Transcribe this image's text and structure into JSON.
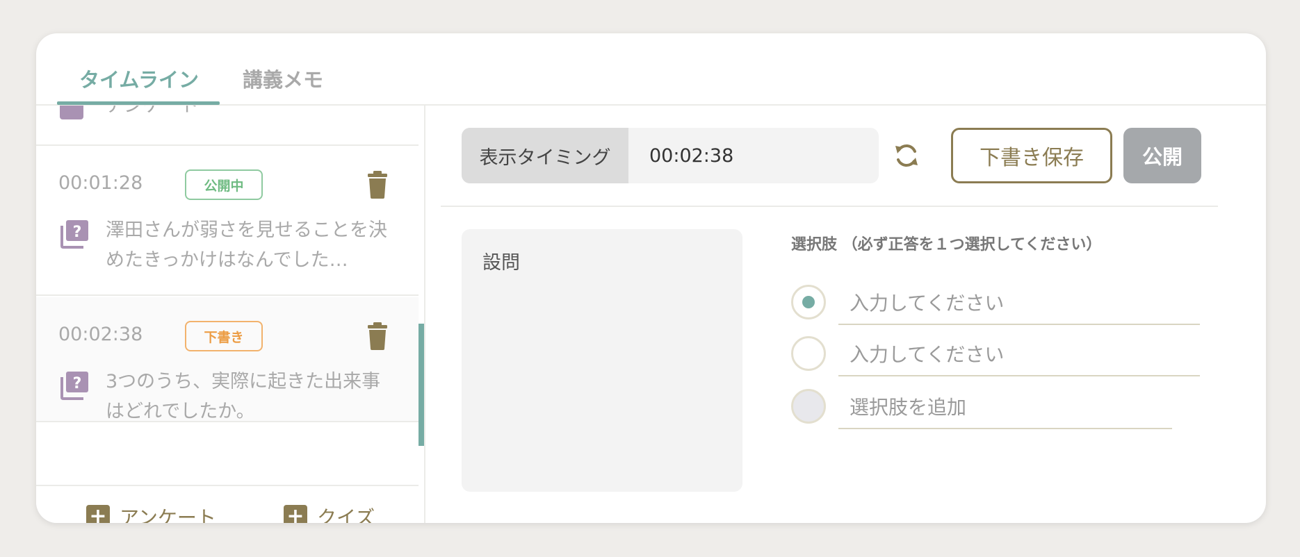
{
  "tabs": [
    {
      "label": "タイムライン",
      "active": true
    },
    {
      "label": "講義メモ",
      "active": false
    }
  ],
  "timeline": {
    "cut_item_label": "アンケート",
    "items": [
      {
        "time": "00:01:28",
        "status": "公開中",
        "text": "澤田さんが弱さを見せることを決めたきっかけはなんでした…"
      },
      {
        "time": "00:02:38",
        "status": "下書き",
        "text": "3つのうち、実際に起きた出来事はどれでしたか。"
      }
    ],
    "add_survey": "アンケート",
    "add_quiz": "クイズ"
  },
  "editor": {
    "timing_label": "表示タイミング",
    "timing_value": "00:02:38",
    "save_draft": "下書き保存",
    "publish": "公開",
    "question_placeholder": "設問",
    "options_title": "選択肢 （必ず正答を１つ選択してください）",
    "option_placeholder": "入力してください",
    "add_option": "選択肢を追加"
  },
  "colors": {
    "accent": "#76aca4",
    "brand": "#8b7c52",
    "published": "#6fbb82",
    "draft": "#ec9d45",
    "quiz_icon": "#a992b3"
  }
}
